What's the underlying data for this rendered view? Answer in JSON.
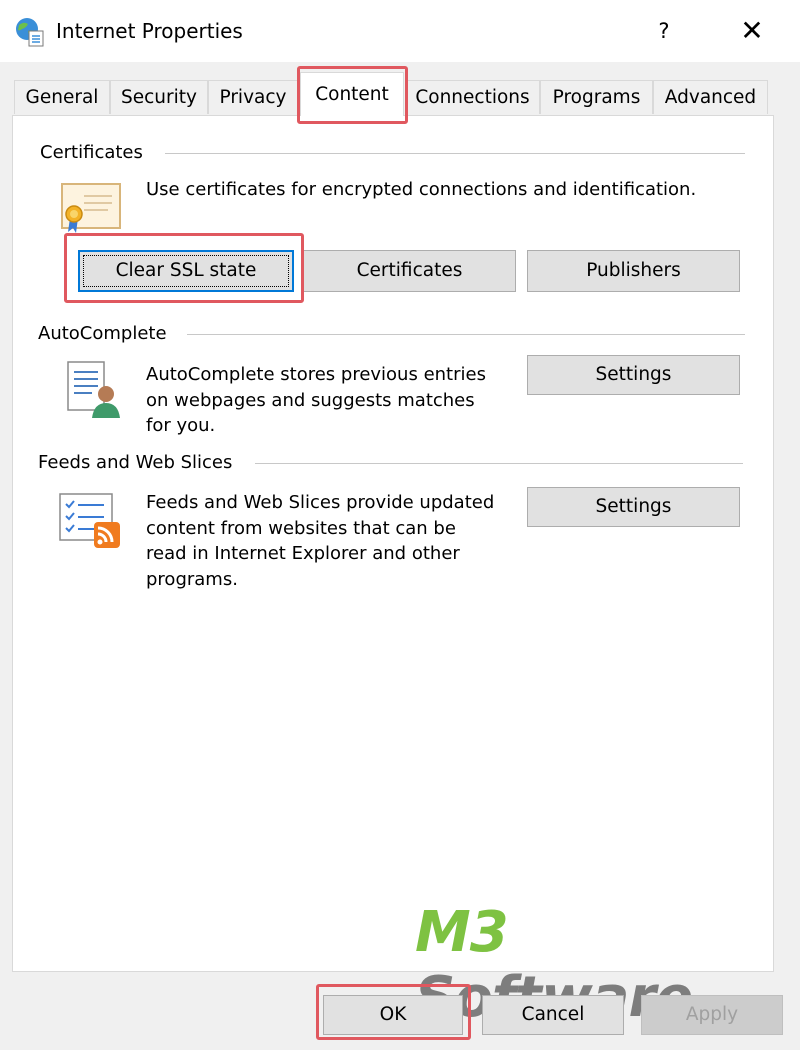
{
  "window": {
    "title": "Internet Properties",
    "help_label": "?",
    "close_label": "✕"
  },
  "tabs": [
    {
      "label": "General"
    },
    {
      "label": "Security"
    },
    {
      "label": "Privacy"
    },
    {
      "label": "Content",
      "active": true
    },
    {
      "label": "Connections"
    },
    {
      "label": "Programs"
    },
    {
      "label": "Advanced"
    }
  ],
  "certificates": {
    "heading": "Certificates",
    "description": "Use certificates for encrypted connections and identification.",
    "clear_ssl_label": "Clear SSL state",
    "certificates_label": "Certificates",
    "publishers_label": "Publishers"
  },
  "autocomplete": {
    "heading": "AutoComplete",
    "description_lines": [
      "AutoComplete stores previous entries",
      "on webpages and suggests matches",
      "for you."
    ],
    "settings_label": "Settings"
  },
  "feeds": {
    "heading": "Feeds and Web Slices",
    "description_lines": [
      "Feeds and Web Slices provide updated",
      "content from websites that can be",
      "read in Internet Explorer and other",
      "programs."
    ],
    "settings_label": "Settings"
  },
  "watermark": {
    "part1": "M3",
    "part2": " Software"
  },
  "footer": {
    "ok_label": "OK",
    "cancel_label": "Cancel",
    "apply_label": "Apply"
  },
  "colors": {
    "highlight": "#e0585f",
    "focus": "#0078d7",
    "logo_green": "#7ec242",
    "logo_gray": "#7d7d7d"
  }
}
